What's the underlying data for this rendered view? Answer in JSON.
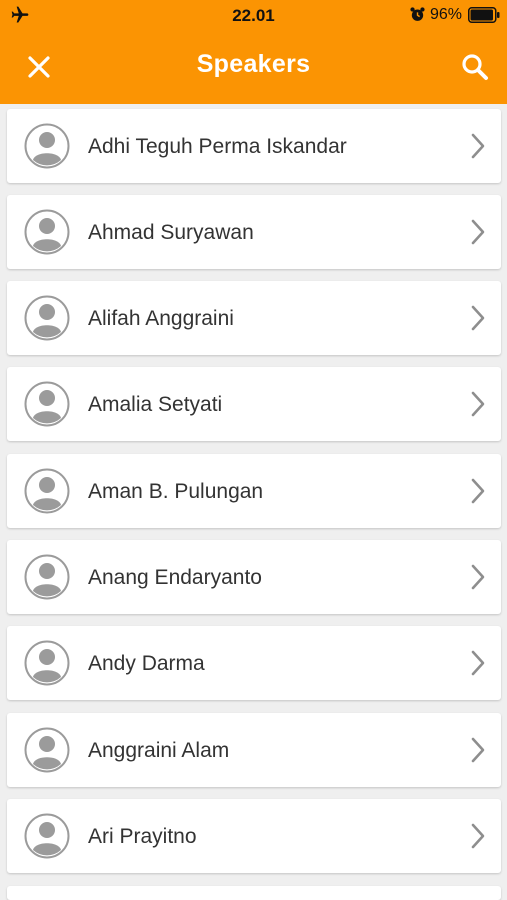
{
  "status_bar": {
    "time": "22.01",
    "battery_percent": "96%",
    "icons": [
      "airplane-mode-icon",
      "alarm-clock-icon",
      "battery-icon"
    ]
  },
  "header": {
    "title": "Speakers",
    "left_icon": "close-icon",
    "right_icon": "search-icon"
  },
  "colors": {
    "accent": "#fb9403",
    "background": "#efefef",
    "card": "#ffffff",
    "text": "#333333",
    "icon_gray": "#9b9b9b"
  },
  "speakers": [
    {
      "name": "Adhi Teguh Perma Iskandar"
    },
    {
      "name": "Ahmad Suryawan"
    },
    {
      "name": "Alifah Anggraini"
    },
    {
      "name": "Amalia Setyati"
    },
    {
      "name": "Aman B. Pulungan"
    },
    {
      "name": "Anang Endaryanto"
    },
    {
      "name": "Andy Darma"
    },
    {
      "name": "Anggraini Alam"
    },
    {
      "name": "Ari Prayitno"
    }
  ]
}
